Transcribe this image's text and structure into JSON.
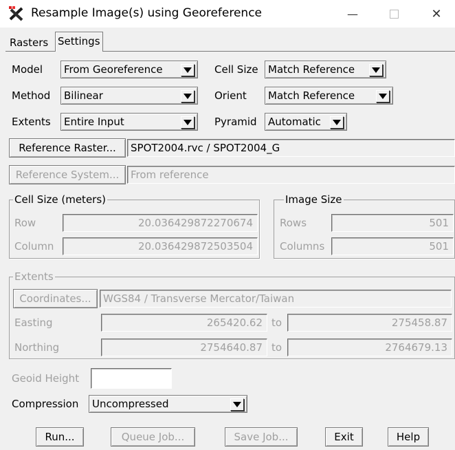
{
  "window": {
    "title": "Resample Image(s) using Georeference",
    "minimize": "—",
    "close": "✕"
  },
  "tabs": [
    "Rasters",
    "Settings"
  ],
  "model": {
    "label": "Model",
    "value": "From Georeference"
  },
  "cell_size": {
    "label": "Cell Size",
    "value": "Match Reference"
  },
  "method": {
    "label": "Method",
    "value": "Bilinear"
  },
  "orient": {
    "label": "Orient",
    "value": "Match Reference"
  },
  "extents_row": {
    "label": "Extents",
    "value": "Entire Input"
  },
  "pyramid": {
    "label": "Pyramid",
    "value": "Automatic"
  },
  "reference_raster": {
    "button": "Reference Raster...",
    "value": "SPOT2004.rvc / SPOT2004_G"
  },
  "reference_system": {
    "button": "Reference System...",
    "value": "From reference"
  },
  "cell_size_group": {
    "title": "Cell Size (meters)",
    "row_label": "Row",
    "row_value": "20.036429872270674",
    "column_label": "Column",
    "column_value": "20.036429872503504"
  },
  "image_size_group": {
    "title": "Image Size",
    "rows_label": "Rows",
    "rows_value": "501",
    "columns_label": "Columns",
    "columns_value": "501"
  },
  "extents_group": {
    "title": "Extents",
    "coordinates_button": "Coordinates...",
    "coordinates_value": "WGS84 / Transverse Mercator/Taiwan",
    "easting_label": "Easting",
    "easting_from": "265420.62",
    "easting_to": "275458.87",
    "northing_label": "Northing",
    "northing_from": "2754640.87",
    "northing_to": "2764679.13",
    "to_label": "to"
  },
  "geoid": {
    "label": "Geoid Height",
    "value": ""
  },
  "compression": {
    "label": "Compression",
    "value": "Uncompressed"
  },
  "buttons": {
    "run": "Run...",
    "queue": "Queue Job...",
    "save": "Save Job...",
    "exit": "Exit",
    "help": "Help"
  }
}
